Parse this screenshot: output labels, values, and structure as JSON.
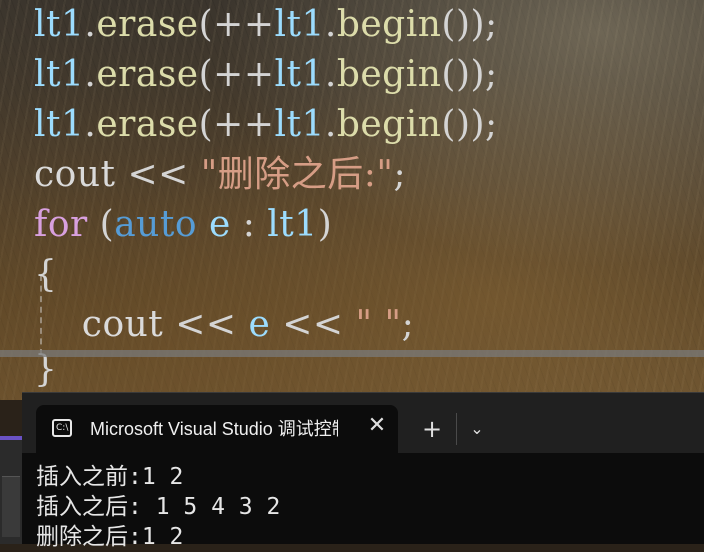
{
  "editor": {
    "lines": [
      {
        "tokens": [
          {
            "t": "lt1",
            "c": "id"
          },
          {
            "t": ".",
            "c": "op"
          },
          {
            "t": "erase",
            "c": "fn"
          },
          {
            "t": "(++",
            "c": "op"
          },
          {
            "t": "lt1",
            "c": "id"
          },
          {
            "t": ".",
            "c": "op"
          },
          {
            "t": "begin",
            "c": "fn"
          },
          {
            "t": "());",
            "c": "op"
          }
        ]
      },
      {
        "tokens": [
          {
            "t": "lt1",
            "c": "id"
          },
          {
            "t": ".",
            "c": "op"
          },
          {
            "t": "erase",
            "c": "fn"
          },
          {
            "t": "(++",
            "c": "op"
          },
          {
            "t": "lt1",
            "c": "id"
          },
          {
            "t": ".",
            "c": "op"
          },
          {
            "t": "begin",
            "c": "fn"
          },
          {
            "t": "());",
            "c": "op"
          }
        ]
      },
      {
        "tokens": [
          {
            "t": "lt1",
            "c": "id"
          },
          {
            "t": ".",
            "c": "op"
          },
          {
            "t": "erase",
            "c": "fn"
          },
          {
            "t": "(++",
            "c": "op"
          },
          {
            "t": "lt1",
            "c": "id"
          },
          {
            "t": ".",
            "c": "op"
          },
          {
            "t": "begin",
            "c": "fn"
          },
          {
            "t": "());",
            "c": "op"
          }
        ]
      },
      {
        "tokens": [
          {
            "t": "cout",
            "c": "plain"
          },
          {
            "t": " << ",
            "c": "op"
          },
          {
            "t": "\"删除之后:\"",
            "c": "str"
          },
          {
            "t": ";",
            "c": "op"
          }
        ]
      },
      {
        "tokens": [
          {
            "t": "for",
            "c": "kw1"
          },
          {
            "t": " (",
            "c": "op"
          },
          {
            "t": "auto",
            "c": "kw2"
          },
          {
            "t": " ",
            "c": "op"
          },
          {
            "t": "e",
            "c": "var"
          },
          {
            "t": " : ",
            "c": "op"
          },
          {
            "t": "lt1",
            "c": "id"
          },
          {
            "t": ")",
            "c": "op"
          }
        ]
      },
      {
        "tokens": [
          {
            "t": "{",
            "c": "op"
          }
        ]
      },
      {
        "tokens": [
          {
            "t": "    ",
            "c": "op"
          },
          {
            "t": "cout",
            "c": "plain"
          },
          {
            "t": " << ",
            "c": "op"
          },
          {
            "t": "e",
            "c": "var"
          },
          {
            "t": " << ",
            "c": "op"
          },
          {
            "t": "\" \"",
            "c": "str"
          },
          {
            "t": ";",
            "c": "op"
          }
        ]
      },
      {
        "tokens": [
          {
            "t": "}",
            "c": "op"
          }
        ]
      }
    ]
  },
  "terminal": {
    "tab_title": "Microsoft Visual Studio 调试控制台",
    "tab_icon_text": "C:\\",
    "close_glyph": "✕",
    "new_tab_glyph": "+",
    "dropdown_glyph": "⌄",
    "output": [
      "插入之前:1 2",
      "插入之后: 1 5 4 3 2",
      "删除之后:1 2"
    ]
  },
  "colors": {
    "identifier": "#9cdcfe",
    "function": "#dcdcaa",
    "string": "#d69d85",
    "keyword_control": "#d8a0df",
    "keyword_type": "#569cd6"
  }
}
